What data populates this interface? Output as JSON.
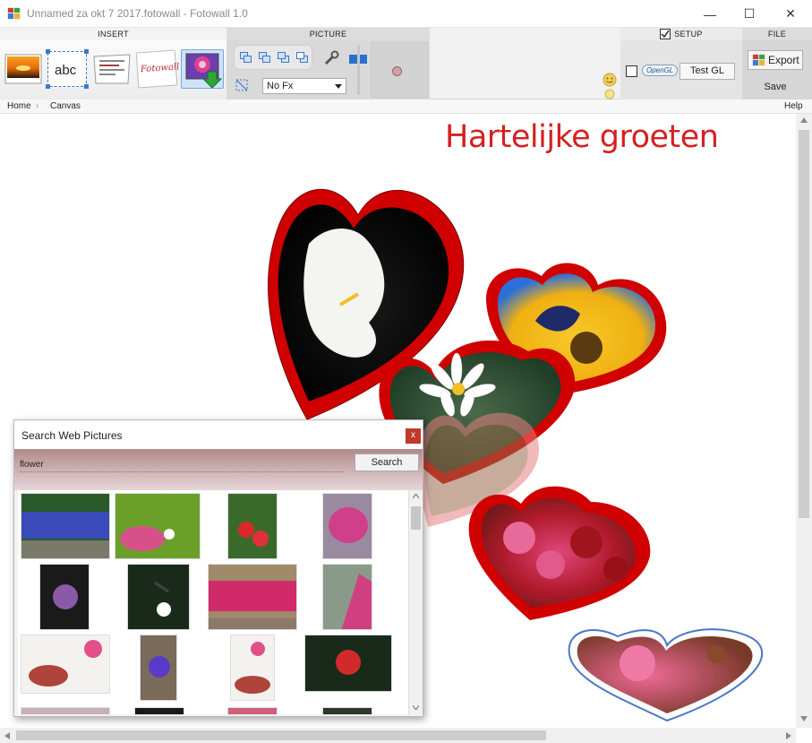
{
  "window": {
    "title": "Unnamed za okt 7 2017.fotowall - Fotowall 1.0",
    "minimize": "—",
    "maximize": "☐",
    "close": "✕"
  },
  "ribbon": {
    "insert_label": "INSERT",
    "picture_label": "PICTURE",
    "setup_label": "SETUP",
    "setup_checked": true,
    "file_label": "FILE",
    "text_tool_label": "abc",
    "word_tool_label": "Fotowall",
    "fx_selected": "No Fx",
    "test_gl_label": "Test GL",
    "opengl_label": "OpenGL",
    "opengl_checked": false,
    "export_label": "Export",
    "save_label": "Save"
  },
  "nav": {
    "home": "Home",
    "separator": "›",
    "canvas": "Canvas",
    "help": "Help"
  },
  "canvas": {
    "title_text": "Hartelijke groeten",
    "title_color": "#d62020"
  },
  "search_dialog": {
    "title": "Search Web Pictures",
    "close_label": "x",
    "query": "flower",
    "search_label": "Search",
    "result_count_visible": 16
  },
  "colors": {
    "heart_border": "#d40000",
    "heart_border_blue": "#4a78c8",
    "dialog_band": "#b28a8c",
    "dialog_close": "#c0392b"
  },
  "icons": [
    "app-icon",
    "sunset-picture-icon",
    "text-tool-icon",
    "newspaper-icon",
    "word-art-icon",
    "web-picture-download-icon",
    "arrange-icon",
    "wrench-icon",
    "smiley-icon",
    "bulb-icon",
    "export-icon",
    "chevron-down-icon"
  ]
}
